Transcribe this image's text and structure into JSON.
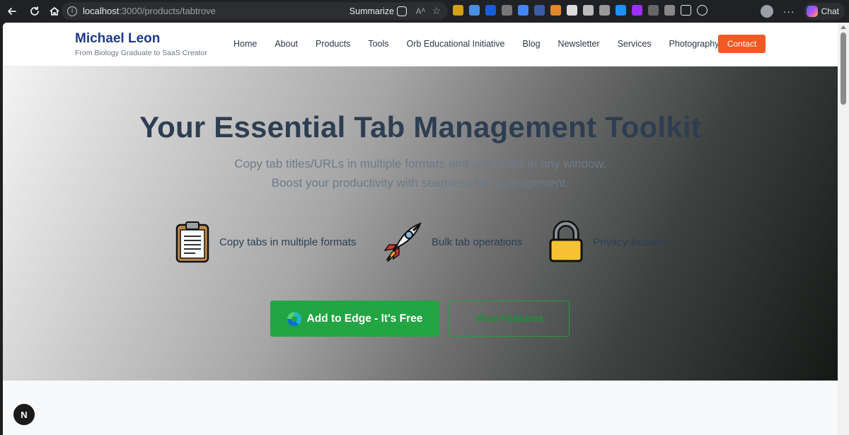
{
  "browser": {
    "url_host": "localhost",
    "url_path": ":3000/products/tabtrove",
    "summarize_label": "Summarize",
    "chat_label": "Chat",
    "icons": [
      "back-icon",
      "reload-icon",
      "home-icon",
      "info-icon",
      "summarize-icon",
      "read-aloud-icon",
      "favorite-star-icon",
      "extensions-icon",
      "favorites-icon",
      "profile-avatar",
      "more-menu-icon",
      "copilot-icon"
    ]
  },
  "site": {
    "brand_name": "Michael Leon",
    "brand_tagline": "From Biology Graduate to SaaS Creator",
    "nav": [
      "Home",
      "About",
      "Products",
      "Tools",
      "Orb Educational Initiative",
      "Blog",
      "Newsletter",
      "Services",
      "Photography"
    ],
    "contact_label": "Contact"
  },
  "hero": {
    "title": "Your Essential Tab Management Toolkit",
    "subtitle": "Copy tab titles/URLs in multiple formats and open tabs in any window. Boost your productivity with seamless tab management.",
    "features": [
      {
        "icon": "clipboard-icon",
        "label": "Copy tabs in multiple formats"
      },
      {
        "icon": "rocket-icon",
        "label": "Bulk tab operations"
      },
      {
        "icon": "lock-icon",
        "label": "Privacy-focused"
      }
    ],
    "primary_button": "Add to Edge - It's Free",
    "secondary_button": "View Features"
  },
  "dev_badge": "N",
  "colors": {
    "brand": "#1e3a8a",
    "contact": "#f05a24",
    "primary_button": "#22a542",
    "title": "#2d3e52"
  }
}
